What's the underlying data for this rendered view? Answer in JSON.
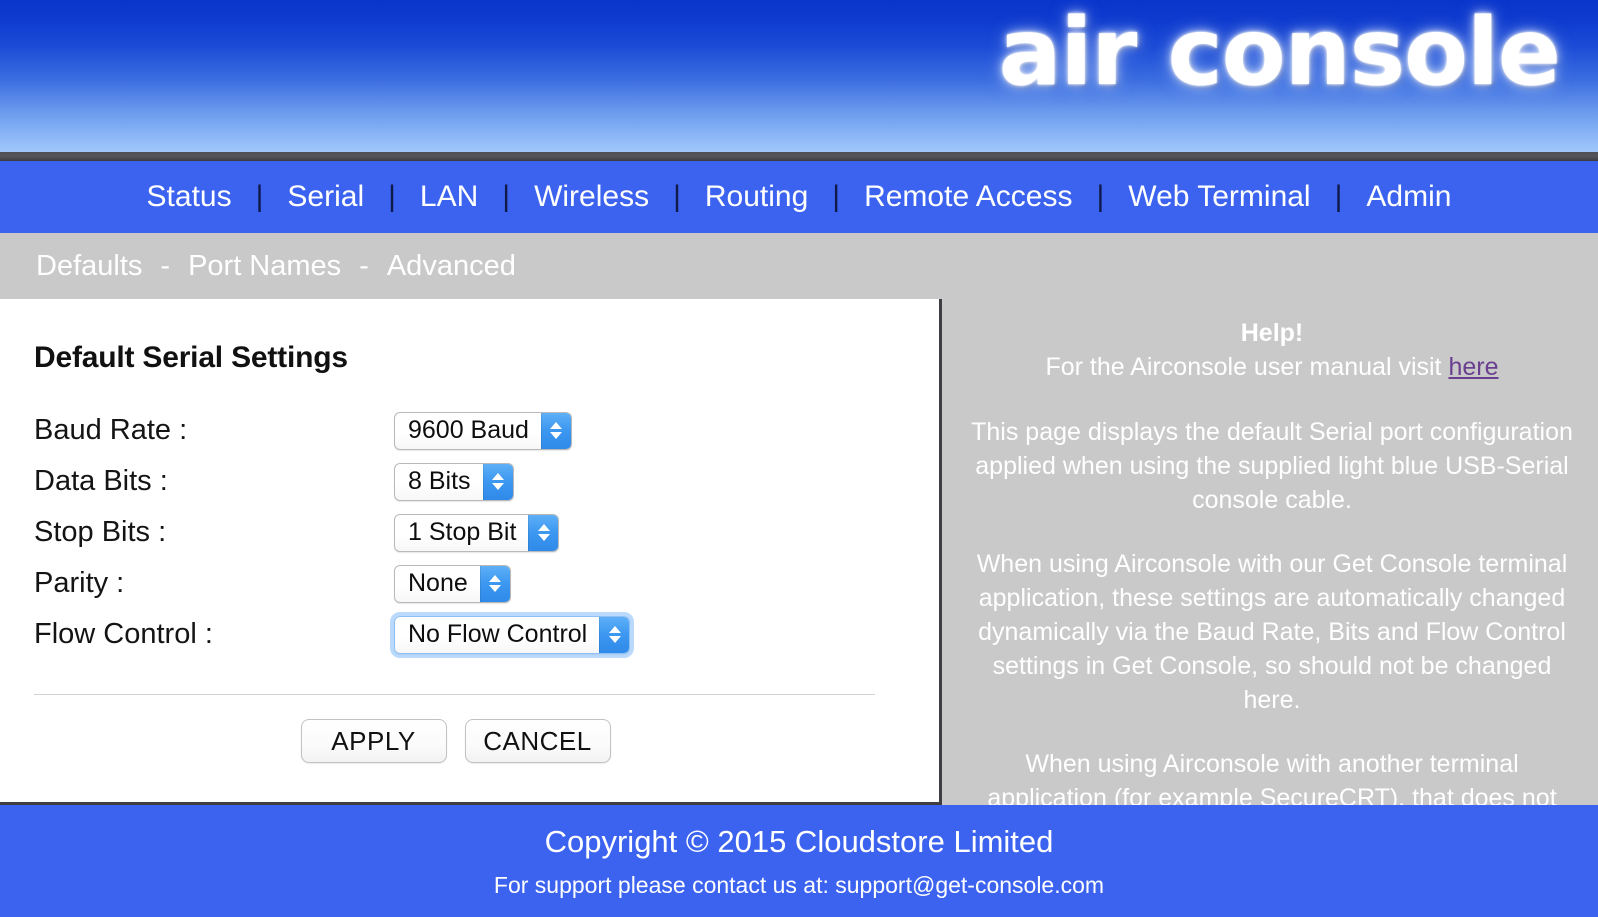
{
  "brand": {
    "logo_text": "air console"
  },
  "main_nav": {
    "separator": "|",
    "items": [
      {
        "label": "Status"
      },
      {
        "label": "Serial"
      },
      {
        "label": "LAN"
      },
      {
        "label": "Wireless"
      },
      {
        "label": "Routing"
      },
      {
        "label": "Remote Access"
      },
      {
        "label": "Web Terminal"
      },
      {
        "label": "Admin"
      }
    ]
  },
  "sub_nav": {
    "separator": "-",
    "items": [
      {
        "label": "Defaults"
      },
      {
        "label": "Port Names"
      },
      {
        "label": "Advanced"
      }
    ]
  },
  "main": {
    "title": "Default Serial Settings",
    "fields": [
      {
        "label": "Baud Rate :",
        "value": "9600 Baud",
        "focused": false
      },
      {
        "label": "Data Bits :",
        "value": "8 Bits",
        "focused": false
      },
      {
        "label": "Stop Bits :",
        "value": "1 Stop Bit",
        "focused": false
      },
      {
        "label": "Parity :",
        "value": "None",
        "focused": false
      },
      {
        "label": "Flow Control :",
        "value": "No Flow Control",
        "focused": true
      }
    ],
    "buttons": {
      "apply": "APPLY",
      "cancel": "CANCEL"
    }
  },
  "help": {
    "title": "Help!",
    "manual_prefix": "For the Airconsole user manual visit ",
    "manual_link": "here",
    "paragraphs": [
      "This page displays the default Serial port configuration applied when using the supplied light blue USB-Serial console cable.",
      "When using Airconsole with our Get Console terminal application, these settings are automatically changed dynamically via the Baud Rate, Bits and Flow Control settings in Get Console, so should not be changed here.",
      "When using Airconsole with another terminal application (for example SecureCRT), that does not comply with RFC2217 Network extensions, the serial port settings can be adjusted on this page and then applied with the APPLY button."
    ]
  },
  "footer": {
    "copyright": "Copyright © 2015 Cloudstore Limited",
    "support": "For support please contact us at: support@get-console.com"
  },
  "colors": {
    "nav_blue": "#3c63f0",
    "header_gradient_top": "#0a35cc",
    "header_gradient_bottom": "#a0c6fb",
    "panel_gray": "#c9c9c9",
    "stepper_blue": "#3b97f0",
    "link_purple": "#6b3f8f"
  }
}
